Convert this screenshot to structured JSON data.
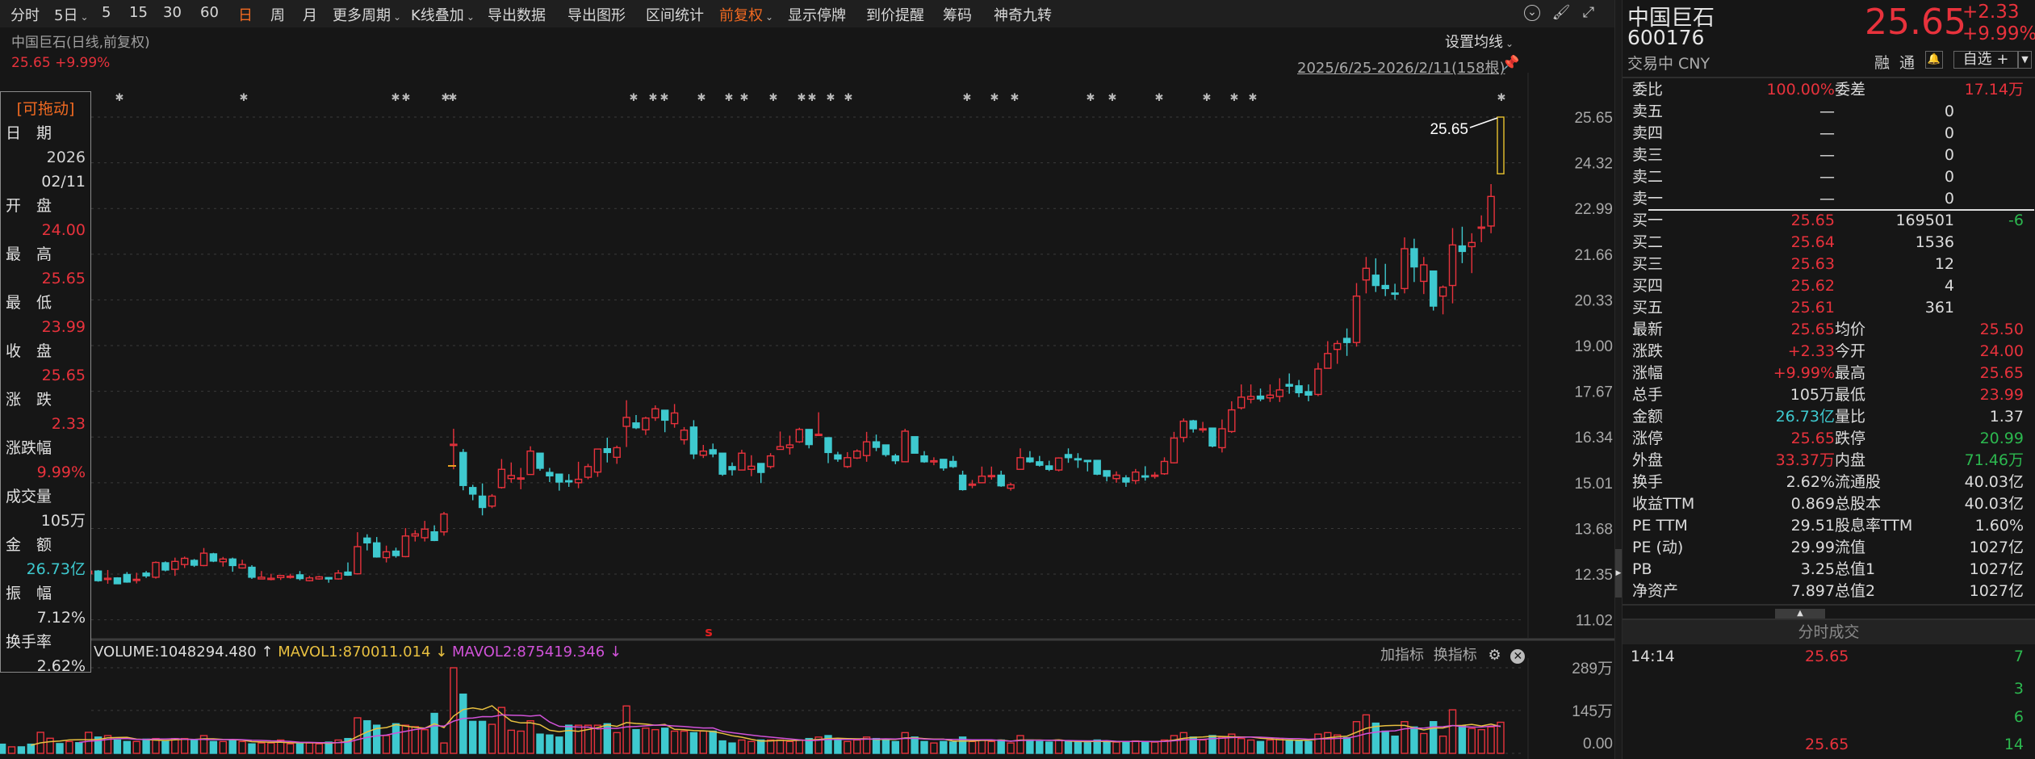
{
  "toolbar": {
    "items": [
      {
        "label": "分时"
      },
      {
        "label": "5日",
        "dropdown": true
      },
      {
        "label": "5"
      },
      {
        "label": "15"
      },
      {
        "label": "30"
      },
      {
        "label": "60"
      },
      {
        "label": "日",
        "active": true
      },
      {
        "label": "周"
      },
      {
        "label": "月"
      },
      {
        "label": "更多周期",
        "dropdown": true
      },
      {
        "label": "K线叠加",
        "dropdown": true
      },
      {
        "label": "导出数据"
      },
      {
        "label": "导出图形"
      },
      {
        "label": "区间统计"
      },
      {
        "label": "前复权",
        "dropdown": true,
        "active": true
      },
      {
        "label": "显示停牌"
      },
      {
        "label": "到价提醒"
      },
      {
        "label": "筹码"
      },
      {
        "label": "神奇九转"
      }
    ],
    "icons": [
      "chevron-circle-icon",
      "brush-icon",
      "fullscreen-icon"
    ]
  },
  "chart_header": {
    "title": "中国巨石(日线,前复权)",
    "last": "25.65 +9.99%",
    "ma_setting": "设置均线",
    "range": "2025/6/25-2026/2/11(158根)",
    "last_price_tag": "25.65"
  },
  "infobox": {
    "drag": "[可拖动]",
    "lines": [
      {
        "label": "日　期",
        "value": "2026"
      },
      {
        "label": "",
        "value": "02/11",
        "plain": true
      },
      {
        "label": "开　盘",
        "value": "24.00",
        "color": "red"
      },
      {
        "label": "最　高",
        "value": "25.65",
        "color": "red"
      },
      {
        "label": "最　低",
        "value": "23.99",
        "color": "red"
      },
      {
        "label": "收　盘",
        "value": "25.65",
        "color": "red"
      },
      {
        "label": "涨　跌",
        "value": "2.33",
        "color": "red"
      },
      {
        "label": "涨跌幅",
        "value": "9.99%",
        "color": "red"
      },
      {
        "label": "成交量",
        "value": "105万"
      },
      {
        "label": "金　额",
        "value": "26.73亿",
        "color": "cyan"
      },
      {
        "label": "振　幅",
        "value": "7.12%"
      },
      {
        "label": "换手率",
        "value": "2.62%"
      }
    ]
  },
  "volume_header": {
    "volume": "VOLUME:1048294.480",
    "volume_arrow": "↑",
    "mavol1": "MAVOL1:870011.014",
    "mavol1_arrow": "↓",
    "mavol2": "MAVOL2:875419.346",
    "mavol2_arrow": "↓",
    "add_indicator": "加指标",
    "switch_indicator": "换指标"
  },
  "colors": {
    "up": "#e8323c",
    "down": "#3ec9cf",
    "selected": "#e8c22e",
    "mavol1": "#e8c040",
    "mavol2": "#d052d8"
  },
  "chart_data": [
    {
      "type": "candlestick",
      "title": "中国巨石(日线,前复权)",
      "bars": 158,
      "y_ticks": [
        "25.65",
        "24.32",
        "22.99",
        "21.66",
        "20.33",
        "19.00",
        "17.67",
        "16.34",
        "15.01",
        "13.68",
        "12.35",
        "11.02"
      ],
      "ylim": [
        11.02,
        25.65
      ],
      "open": [
        12.3,
        12.35,
        12.28,
        12.4,
        12.33,
        12.25,
        12.3,
        12.38,
        12.3,
        12.42,
        12.36,
        12.44,
        12.22,
        12.24,
        12.34,
        12.17,
        12.38,
        12.26,
        12.68,
        12.49,
        12.63,
        12.75,
        12.6,
        12.94,
        12.71,
        12.79,
        12.53,
        12.55,
        12.21,
        12.22,
        12.25,
        12.27,
        12.33,
        12.16,
        12.21,
        12.25,
        12.21,
        12.41,
        12.36,
        13.4,
        13.26,
        12.83,
        13.02,
        12.86,
        13.46,
        13.41,
        13.58,
        13.58,
        16.1,
        15.89,
        14.87,
        14.62,
        14.33,
        14.87,
        15.13,
        15.14,
        15.25,
        15.87,
        15.31,
        15.26,
        15.07,
        15.01,
        15.17,
        15.32,
        16.0,
        15.75,
        16.65,
        16.75,
        16.55,
        16.9,
        17.12,
        16.73,
        16.26,
        16.63,
        15.81,
        15.97,
        15.87,
        15.48,
        15.38,
        15.4,
        15.57,
        15.48,
        15.98,
        16.03,
        16.2,
        16.56,
        16.42,
        16.32,
        15.82,
        15.48,
        15.73,
        15.8,
        16.2,
        16.11,
        15.79,
        15.62,
        16.35,
        15.79,
        15.63,
        15.69,
        15.63,
        15.23,
        14.96,
        15.01,
        15.19,
        15.23,
        14.85,
        15.4,
        15.73,
        15.62,
        15.5,
        15.38,
        15.83,
        15.71,
        15.66,
        15.66,
        15.36,
        15.13,
        15.15,
        15.07,
        15.21,
        15.22,
        15.27,
        15.59,
        16.33,
        16.81,
        16.56,
        16.6,
        16.03,
        16.5,
        17.19,
        17.44,
        17.53,
        17.48,
        17.52,
        17.87,
        17.83,
        17.66,
        17.58,
        18.34,
        18.89,
        19.21,
        19.09,
        20.91,
        21.05,
        20.75,
        20.53,
        20.66,
        21.82,
        20.87,
        21.17,
        20.44,
        20.75,
        21.9,
        21.88,
        22.43,
        22.48,
        24.0
      ],
      "high": [
        12.45,
        12.48,
        12.44,
        12.52,
        12.46,
        12.4,
        12.45,
        12.5,
        12.44,
        12.55,
        12.5,
        12.47,
        12.47,
        12.26,
        12.41,
        12.39,
        12.44,
        12.72,
        12.72,
        12.83,
        12.86,
        12.79,
        13.11,
        12.97,
        12.85,
        12.83,
        12.77,
        12.61,
        12.44,
        12.36,
        12.32,
        12.36,
        12.44,
        12.3,
        12.3,
        12.26,
        12.47,
        12.69,
        13.57,
        13.51,
        13.43,
        13.18,
        13.12,
        13.69,
        13.63,
        13.9,
        13.77,
        14.16,
        16.58,
        15.99,
        14.95,
        14.99,
        14.68,
        15.7,
        15.6,
        15.44,
        16.07,
        15.87,
        15.44,
        15.26,
        15.26,
        15.62,
        15.56,
        16.0,
        16.32,
        16.09,
        17.41,
        16.98,
        16.93,
        17.26,
        17.12,
        17.3,
        16.63,
        16.83,
        16.11,
        16.15,
        15.87,
        15.6,
        15.97,
        15.81,
        15.57,
        15.87,
        16.5,
        16.38,
        16.61,
        16.56,
        17.06,
        16.32,
        15.91,
        15.9,
        15.98,
        16.49,
        16.41,
        16.11,
        15.85,
        16.58,
        16.35,
        15.93,
        15.75,
        15.69,
        15.79,
        15.36,
        15.09,
        15.48,
        15.48,
        15.36,
        15.01,
        16.01,
        15.93,
        15.79,
        15.65,
        15.75,
        16.01,
        15.87,
        15.67,
        15.66,
        15.36,
        15.34,
        15.23,
        15.41,
        15.49,
        15.32,
        15.75,
        16.49,
        16.88,
        16.84,
        16.78,
        16.6,
        16.85,
        17.38,
        17.87,
        17.87,
        17.75,
        17.87,
        18.05,
        18.19,
        18.0,
        17.87,
        18.5,
        19.13,
        19.15,
        19.5,
        20.82,
        21.58,
        21.54,
        21.38,
        20.8,
        22.15,
        22.11,
        21.58,
        21.17,
        20.75,
        22.42,
        22.46,
        22.27,
        22.79,
        23.7,
        25.65
      ],
      "low": [
        12.2,
        12.25,
        12.18,
        12.28,
        12.22,
        12.15,
        12.2,
        12.26,
        12.22,
        12.3,
        12.28,
        12.13,
        12.07,
        12.06,
        12.1,
        12.08,
        12.24,
        12.22,
        12.43,
        12.3,
        12.53,
        12.56,
        12.58,
        12.7,
        12.57,
        12.42,
        12.51,
        12.21,
        12.2,
        12.17,
        12.18,
        12.22,
        12.17,
        12.14,
        12.19,
        12.1,
        12.19,
        12.3,
        12.34,
        13.04,
        12.83,
        12.69,
        12.83,
        12.84,
        13.3,
        13.3,
        13.31,
        13.47,
        15.4,
        14.79,
        14.5,
        14.06,
        14.27,
        14.84,
        15.01,
        14.82,
        15.24,
        15.36,
        15.03,
        14.78,
        14.89,
        14.85,
        15.11,
        15.18,
        15.6,
        15.56,
        16.05,
        16.57,
        16.4,
        16.81,
        16.48,
        16.61,
        16.12,
        15.7,
        15.73,
        15.75,
        15.21,
        15.22,
        15.38,
        15.2,
        15.0,
        15.42,
        15.97,
        15.83,
        16.17,
        16.01,
        16.41,
        15.58,
        15.62,
        15.44,
        15.7,
        15.62,
        15.93,
        15.77,
        15.55,
        15.62,
        15.87,
        15.59,
        15.52,
        15.36,
        15.44,
        14.78,
        14.85,
        15.0,
        15.1,
        14.89,
        14.78,
        15.4,
        15.59,
        15.48,
        15.35,
        15.34,
        15.59,
        15.44,
        15.34,
        15.23,
        15.05,
        15.01,
        14.89,
        14.97,
        15.07,
        15.13,
        15.24,
        15.57,
        16.19,
        16.47,
        16.47,
        16.04,
        15.89,
        16.46,
        17.14,
        17.32,
        17.38,
        17.36,
        17.36,
        17.6,
        17.5,
        17.38,
        17.53,
        18.34,
        18.47,
        18.7,
        18.97,
        20.52,
        20.56,
        20.44,
        20.33,
        20.52,
        20.85,
        20.5,
        20.02,
        19.91,
        20.23,
        21.4,
        21.11,
        22.01,
        22.27,
        23.99
      ],
      "close": [
        12.35,
        12.28,
        12.4,
        12.33,
        12.25,
        12.3,
        12.38,
        12.3,
        12.42,
        12.36,
        12.44,
        12.16,
        12.23,
        12.07,
        12.12,
        12.2,
        12.3,
        12.69,
        12.47,
        12.72,
        12.81,
        12.61,
        12.96,
        12.73,
        12.79,
        12.6,
        12.63,
        12.26,
        12.26,
        12.23,
        12.31,
        12.29,
        12.22,
        12.24,
        12.27,
        12.21,
        12.38,
        12.32,
        13.15,
        13.26,
        12.85,
        13.0,
        12.89,
        13.46,
        13.52,
        13.66,
        13.33,
        14.1,
        16.13,
        14.93,
        14.68,
        14.29,
        14.62,
        15.4,
        15.22,
        15.15,
        15.93,
        15.43,
        15.21,
        15.03,
        15.05,
        15.11,
        15.48,
        15.99,
        15.89,
        16.03,
        16.91,
        16.61,
        16.89,
        17.16,
        16.83,
        17.04,
        16.54,
        15.85,
        15.93,
        15.85,
        15.26,
        15.39,
        15.87,
        15.49,
        15.31,
        15.79,
        16.06,
        16.11,
        16.56,
        16.12,
        16.42,
        15.89,
        15.7,
        15.74,
        15.93,
        16.2,
        16.04,
        15.83,
        15.65,
        16.51,
        15.87,
        15.62,
        15.65,
        15.44,
        15.48,
        14.81,
        14.97,
        15.2,
        15.22,
        14.92,
        14.95,
        15.74,
        15.62,
        15.52,
        15.4,
        15.73,
        15.74,
        15.69,
        15.63,
        15.26,
        15.2,
        15.23,
        15.03,
        15.32,
        15.2,
        15.23,
        15.63,
        16.31,
        16.8,
        16.58,
        16.58,
        16.08,
        16.58,
        17.13,
        17.5,
        17.52,
        17.45,
        17.56,
        17.71,
        17.82,
        17.63,
        17.56,
        18.32,
        18.77,
        19.06,
        19.09,
        20.44,
        21.25,
        20.75,
        20.66,
        20.52,
        21.82,
        21.29,
        21.35,
        20.15,
        20.7,
        21.93,
        21.74,
        22.0,
        22.45,
        23.34,
        25.65
      ],
      "volume_wan": [
        30,
        31,
        22,
        22,
        31,
        71,
        51,
        33,
        40,
        36,
        71,
        55,
        60,
        45,
        40,
        40,
        48,
        50,
        40,
        50,
        50,
        45,
        60,
        40,
        40,
        45,
        40,
        32,
        35,
        35,
        45,
        32,
        32,
        35,
        32,
        38,
        45,
        50,
        120,
        110,
        95,
        60,
        100,
        95,
        90,
        80,
        135,
        35,
        289,
        200,
        108,
        108,
        98,
        155,
        78,
        75,
        110,
        65,
        62,
        55,
        95,
        95,
        95,
        95,
        100,
        70,
        160,
        80,
        85,
        80,
        85,
        75,
        75,
        70,
        75,
        75,
        42,
        35,
        45,
        40,
        45,
        45,
        45,
        40,
        45,
        50,
        55,
        60,
        45,
        40,
        45,
        55,
        50,
        45,
        40,
        70,
        55,
        40,
        35,
        40,
        38,
        55,
        40,
        45,
        40,
        45,
        35,
        60,
        45,
        40,
        38,
        45,
        40,
        38,
        36,
        45,
        40,
        38,
        40,
        42,
        40,
        38,
        45,
        60,
        70,
        55,
        45,
        60,
        55,
        65,
        50,
        45,
        40,
        45,
        50,
        45,
        42,
        40,
        65,
        70,
        62,
        53,
        107,
        130,
        102,
        75,
        58,
        107,
        89,
        67,
        107,
        58,
        147,
        93,
        84,
        80,
        89,
        105
      ],
      "volume_ticks": [
        "289万",
        "145万",
        "0.00"
      ],
      "volume_ylim_wan": [
        0,
        289
      ],
      "mavol_periods": [
        5,
        10
      ],
      "signal_marker": "s"
    }
  ],
  "quote": {
    "name": "中国巨石",
    "code": "600176",
    "status": "交易中 CNY",
    "price": "25.65",
    "change": "+2.33",
    "change_pct": "+9.99%",
    "margin_label": "融",
    "connect_label": "通",
    "watchlist_label": "自选 +",
    "ratio_row": {
      "l1": "委比",
      "v1": "100.00%",
      "l2": "委差",
      "v2": "17.14万"
    },
    "asks": [
      {
        "label": "卖五",
        "price": "—",
        "vol": "0"
      },
      {
        "label": "卖四",
        "price": "—",
        "vol": "0"
      },
      {
        "label": "卖三",
        "price": "—",
        "vol": "0"
      },
      {
        "label": "卖二",
        "price": "—",
        "vol": "0"
      },
      {
        "label": "卖一",
        "price": "—",
        "vol": "0"
      }
    ],
    "bids": [
      {
        "label": "买一",
        "price": "25.65",
        "vol": "169501",
        "delta": "-6"
      },
      {
        "label": "买二",
        "price": "25.64",
        "vol": "1536",
        "delta": ""
      },
      {
        "label": "买三",
        "price": "25.63",
        "vol": "12",
        "delta": ""
      },
      {
        "label": "买四",
        "price": "25.62",
        "vol": "4",
        "delta": ""
      },
      {
        "label": "买五",
        "price": "25.61",
        "vol": "361",
        "delta": ""
      }
    ],
    "stats": [
      {
        "l1": "最新",
        "v1": "25.65",
        "c1": "red",
        "l2": "均价",
        "v2": "25.50",
        "c2": "red"
      },
      {
        "l1": "涨跌",
        "v1": "+2.33",
        "c1": "red",
        "l2": "今开",
        "v2": "24.00",
        "c2": "red"
      },
      {
        "l1": "涨幅",
        "v1": "+9.99%",
        "c1": "red",
        "l2": "最高",
        "v2": "25.65",
        "c2": "red"
      },
      {
        "l1": "总手",
        "v1": "105万",
        "c1": "white",
        "l2": "最低",
        "v2": "23.99",
        "c2": "red"
      },
      {
        "l1": "金额",
        "v1": "26.73亿",
        "c1": "cyan",
        "l2": "量比",
        "v2": "1.37",
        "c2": "white"
      },
      {
        "l1": "涨停",
        "v1": "25.65",
        "c1": "red",
        "l2": "跌停",
        "v2": "20.99",
        "c2": "green"
      },
      {
        "l1": "外盘",
        "v1": "33.37万",
        "c1": "red",
        "l2": "内盘",
        "v2": "71.46万",
        "c2": "green"
      },
      {
        "l1": "换手",
        "v1": "2.62%",
        "c1": "white",
        "l2": "流通股",
        "v2": "40.03亿",
        "c2": "white"
      },
      {
        "l1": "收益TTM",
        "v1": "0.869",
        "c1": "white",
        "l2": "总股本",
        "v2": "40.03亿",
        "c2": "white"
      },
      {
        "l1": "PE TTM",
        "v1": "29.51",
        "c1": "white",
        "l2": "股息率TTM",
        "v2": "1.60%",
        "c2": "white"
      },
      {
        "l1": "PE (动)",
        "v1": "29.99",
        "c1": "white",
        "l2": "流值",
        "v2": "1027亿",
        "c2": "white"
      },
      {
        "l1": "PB",
        "v1": "3.25",
        "c1": "white",
        "l2": "总值1",
        "v2": "1027亿",
        "c2": "white"
      },
      {
        "l1": "净资产",
        "v1": "7.897",
        "c1": "white",
        "l2": "总值2",
        "v2": "1027亿",
        "c2": "white"
      }
    ]
  },
  "trades": {
    "title": "分时成交",
    "rows": [
      {
        "time": "14:14",
        "price": "25.65",
        "vol": "7"
      },
      {
        "time": "",
        "price": "",
        "vol": "3"
      },
      {
        "time": "",
        "price": "",
        "vol": "6"
      },
      {
        "time": "",
        "price": "25.65",
        "vol": "14"
      }
    ]
  }
}
